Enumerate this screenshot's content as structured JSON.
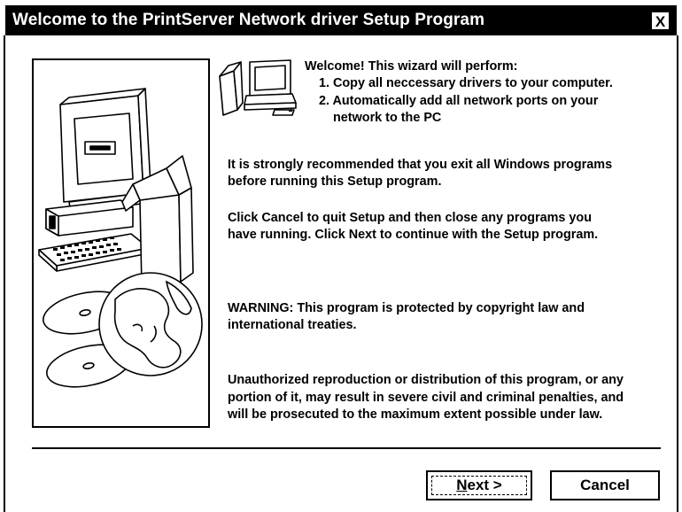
{
  "window": {
    "title": "Welcome to the PrintServer Network driver Setup Program",
    "close_label": "X"
  },
  "intro": {
    "heading": "Welcome! This wizard will perform:",
    "step1": "1. Copy all neccessary drivers to your computer.",
    "step2_line1": "2. Automatically add all network ports on your",
    "step2_line2": "network to the PC"
  },
  "recommend": {
    "line1": "It is strongly recommended that you exit all Windows programs",
    "line2": "before running this Setup program."
  },
  "instructions": {
    "line1": "Click Cancel to quit Setup and then close any programs you",
    "line2": "have running. Click Next to continue with the Setup program."
  },
  "warning": {
    "line1": "WARNING: This program is protected by copyright law and",
    "line2": "international treaties."
  },
  "legal": {
    "line1": "Unauthorized reproduction or distribution  of this program, or any",
    "line2": "portion of it, may result in severe civil and criminal penalties, and",
    "line3": "will be prosecuted to the maximum extent possible under law."
  },
  "buttons": {
    "next_mnemonic": "N",
    "next_rest": "ext >",
    "cancel": "Cancel"
  },
  "icons": [
    "computer-box-illustration",
    "globe-icon",
    "cd-disc-icon",
    "small-computer-icon",
    "close-icon"
  ]
}
